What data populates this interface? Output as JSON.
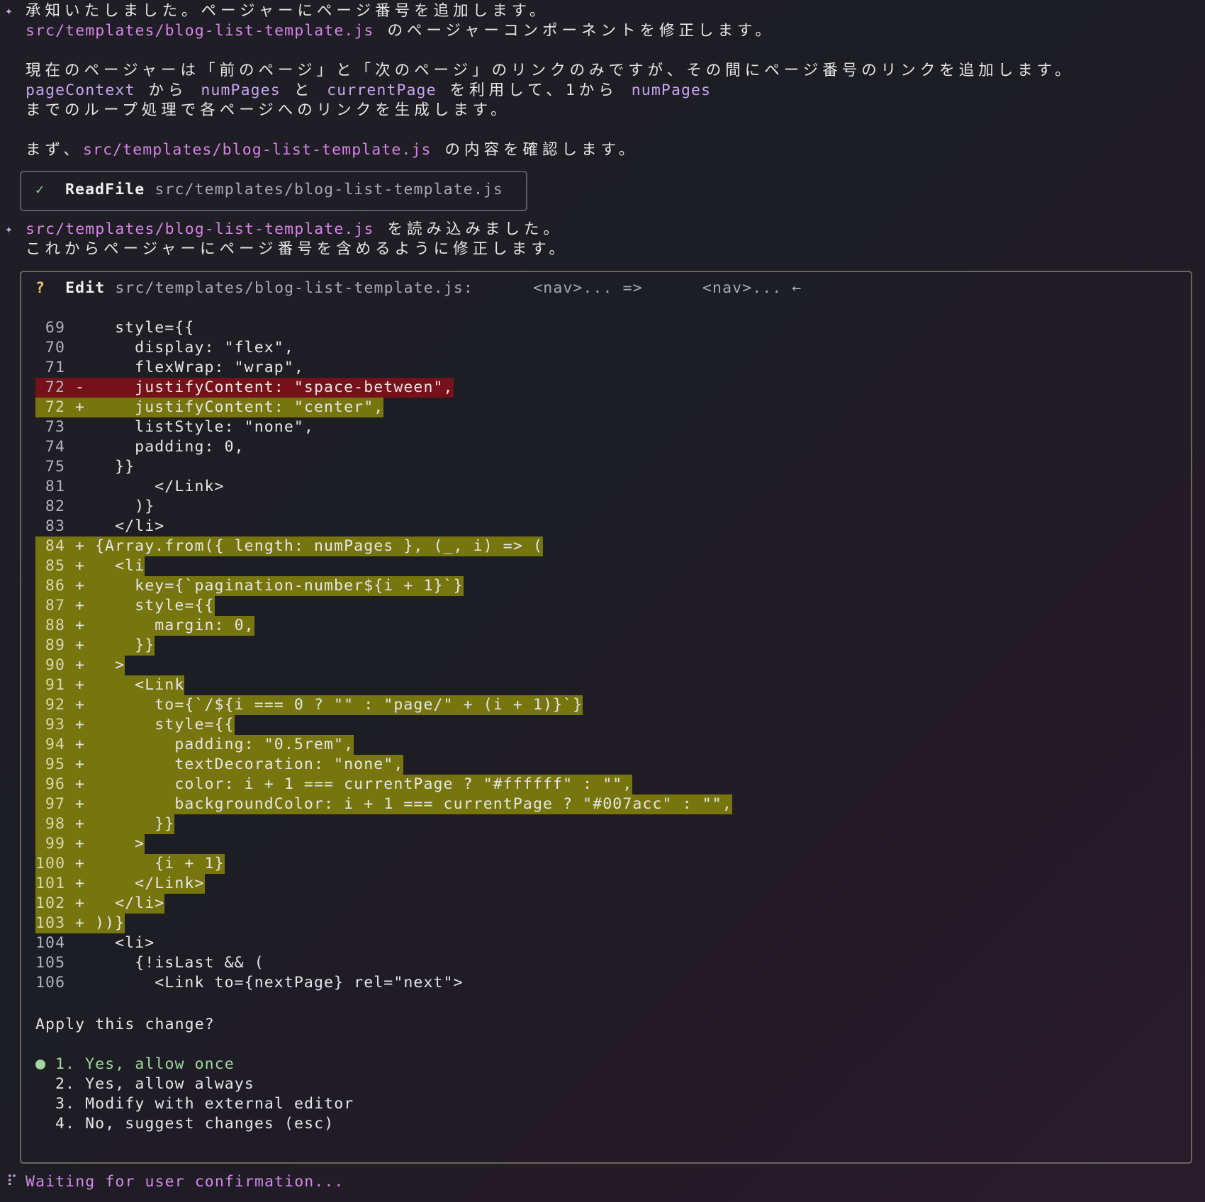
{
  "messages": [
    {
      "line1": "承知いたしました。ページャーにページ番号を追加します。",
      "line2_path": "src/templates/blog-list-template.js",
      "line2_rest": " のページャーコンポーネントを修正します。"
    }
  ],
  "para": {
    "l1": "現在のページャーは「前のページ」と「次のページ」のリンクのみですが、その間にページ番号のリンクを追加します。",
    "l2a": "pageContext",
    "l2b": " から ",
    "l2c": "numPages",
    "l2d": " と ",
    "l2e": "currentPage",
    "l2f": " を利用して、1から ",
    "l2g": "numPages",
    "l3": "までのループ処理で各ページへのリンクを生成します。",
    "l4a": "まず、",
    "l4b": "src/templates/blog-list-template.js",
    "l4c": " の内容を確認します。"
  },
  "tool": {
    "icon": "check-icon",
    "name": "ReadFile",
    "arg": "src/templates/blog-list-template.js"
  },
  "msg2": {
    "path": "src/templates/blog-list-template.js",
    "rest": " を読み込みました。",
    "l2": "これからページャーにページ番号を含めるように修正します。"
  },
  "edit": {
    "icon": "?",
    "title": "Edit",
    "path": "src/templates/blog-list-template.js:",
    "from": "<nav>... =>",
    "to": "<nav>... ←",
    "question": "Apply this change?",
    "options": [
      "1. Yes, allow once",
      "2. Yes, allow always",
      "3. Modify with external editor",
      "4. No, suggest changes (esc)"
    ],
    "selected_index": 0
  },
  "diff": [
    {
      "n": "69",
      "s": "",
      "t": "  style={{",
      "k": "ctx"
    },
    {
      "n": "70",
      "s": "",
      "t": "    display: \"flex\",",
      "k": "ctx"
    },
    {
      "n": "71",
      "s": "",
      "t": "    flexWrap: \"wrap\",",
      "k": "ctx"
    },
    {
      "n": "72",
      "s": "-",
      "t": "    justifyContent: \"space-between\",",
      "k": "del"
    },
    {
      "n": "72",
      "s": "+",
      "t": "    justifyContent: \"center\",",
      "k": "add"
    },
    {
      "n": "73",
      "s": "",
      "t": "    listStyle: \"none\",",
      "k": "ctx"
    },
    {
      "n": "74",
      "s": "",
      "t": "    padding: 0,",
      "k": "ctx"
    },
    {
      "n": "75",
      "s": "",
      "t": "  }}",
      "k": "ctx"
    },
    {
      "n": "81",
      "s": "",
      "t": "      </Link>",
      "k": "ctx"
    },
    {
      "n": "82",
      "s": "",
      "t": "    )}",
      "k": "ctx"
    },
    {
      "n": "83",
      "s": "",
      "t": "  </li>",
      "k": "ctx"
    },
    {
      "n": "84",
      "s": "+",
      "t": "{Array.from({ length: numPages }, (_, i) => (",
      "k": "add"
    },
    {
      "n": "85",
      "s": "+",
      "t": "  <li",
      "k": "add"
    },
    {
      "n": "86",
      "s": "+",
      "t": "    key={`pagination-number${i + 1}`}",
      "k": "add"
    },
    {
      "n": "87",
      "s": "+",
      "t": "    style={{",
      "k": "add"
    },
    {
      "n": "88",
      "s": "+",
      "t": "      margin: 0,",
      "k": "add"
    },
    {
      "n": "89",
      "s": "+",
      "t": "    }}",
      "k": "add"
    },
    {
      "n": "90",
      "s": "+",
      "t": "  >",
      "k": "add"
    },
    {
      "n": "91",
      "s": "+",
      "t": "    <Link",
      "k": "add"
    },
    {
      "n": "92",
      "s": "+",
      "t": "      to={`/${i === 0 ? \"\" : \"page/\" + (i + 1)}`}",
      "k": "add"
    },
    {
      "n": "93",
      "s": "+",
      "t": "      style={{",
      "k": "add"
    },
    {
      "n": "94",
      "s": "+",
      "t": "        padding: \"0.5rem\",",
      "k": "add"
    },
    {
      "n": "95",
      "s": "+",
      "t": "        textDecoration: \"none\",",
      "k": "add"
    },
    {
      "n": "96",
      "s": "+",
      "t": "        color: i + 1 === currentPage ? \"#ffffff\" : \"\",",
      "k": "add"
    },
    {
      "n": "97",
      "s": "+",
      "t": "        backgroundColor: i + 1 === currentPage ? \"#007acc\" : \"\",",
      "k": "add"
    },
    {
      "n": "98",
      "s": "+",
      "t": "      }}",
      "k": "add"
    },
    {
      "n": "99",
      "s": "+",
      "t": "    >",
      "k": "add"
    },
    {
      "n": "100",
      "s": "+",
      "t": "      {i + 1}",
      "k": "add"
    },
    {
      "n": "101",
      "s": "+",
      "t": "    </Link>",
      "k": "add"
    },
    {
      "n": "102",
      "s": "+",
      "t": "  </li>",
      "k": "add"
    },
    {
      "n": "103",
      "s": "+",
      "t": "))}",
      "k": "add"
    },
    {
      "n": "104",
      "s": "",
      "t": "  <li>",
      "k": "ctx"
    },
    {
      "n": "105",
      "s": "",
      "t": "    {!isLast && (",
      "k": "ctx"
    },
    {
      "n": "106",
      "s": "",
      "t": "      <Link to={nextPage} rel=\"next\">",
      "k": "ctx"
    }
  ],
  "status": {
    "spinner": "⠏",
    "text": "Waiting for user confirmation..."
  },
  "colors": {
    "added_bg": "#77760e",
    "deleted_bg": "#76101a",
    "path": "#d883e8",
    "selected": "#9fd79f"
  }
}
